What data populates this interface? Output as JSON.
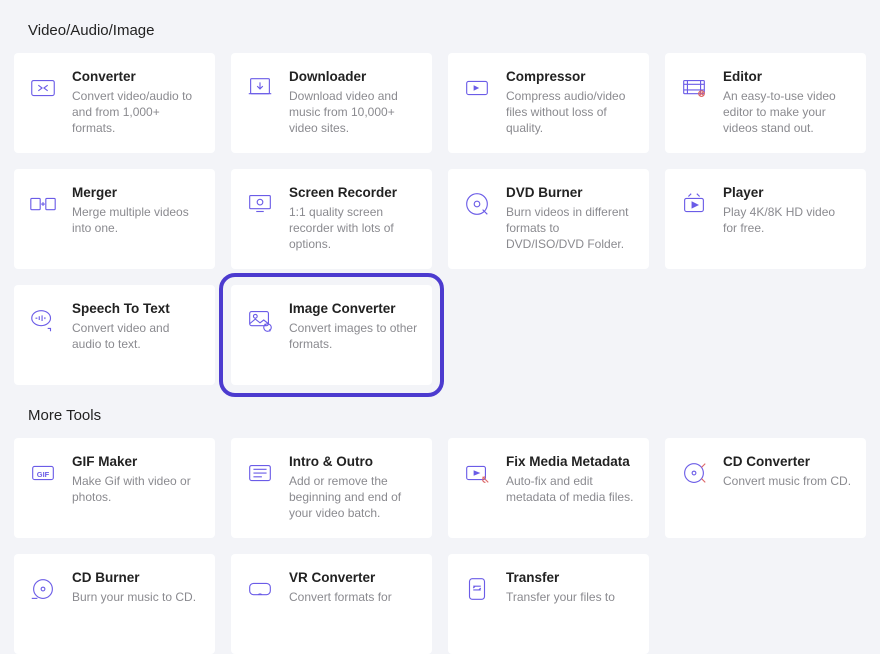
{
  "sections": [
    {
      "title": "Video/Audio/Image",
      "items": [
        {
          "id": "converter",
          "title": "Converter",
          "desc": "Convert video/audio to and from 1,000+ formats.",
          "highlight": false
        },
        {
          "id": "downloader",
          "title": "Downloader",
          "desc": "Download video and music from 10,000+ video sites.",
          "highlight": false
        },
        {
          "id": "compressor",
          "title": "Compressor",
          "desc": "Compress audio/video files without loss of quality.",
          "highlight": false
        },
        {
          "id": "editor",
          "title": "Editor",
          "desc": "An easy-to-use video editor to make your videos stand out.",
          "highlight": false
        },
        {
          "id": "merger",
          "title": "Merger",
          "desc": "Merge multiple videos into one.",
          "highlight": false
        },
        {
          "id": "screen-recorder",
          "title": "Screen Recorder",
          "desc": "1:1 quality screen recorder with lots of options.",
          "highlight": false
        },
        {
          "id": "dvd-burner",
          "title": "DVD Burner",
          "desc": "Burn videos in different formats to DVD/ISO/DVD Folder.",
          "highlight": false
        },
        {
          "id": "player",
          "title": "Player",
          "desc": "Play 4K/8K HD video for free.",
          "highlight": false
        },
        {
          "id": "speech-to-text",
          "title": "Speech To Text",
          "desc": "Convert video and audio to text.",
          "highlight": false
        },
        {
          "id": "image-converter",
          "title": "Image Converter",
          "desc": "Convert images to other formats.",
          "highlight": true
        }
      ]
    },
    {
      "title": "More Tools",
      "items": [
        {
          "id": "gif-maker",
          "title": "GIF Maker",
          "desc": "Make Gif with video or photos.",
          "highlight": false
        },
        {
          "id": "intro-outro",
          "title": "Intro & Outro",
          "desc": "Add or remove the beginning and end of your video batch.",
          "highlight": false
        },
        {
          "id": "fix-media-metadata",
          "title": "Fix Media Metadata",
          "desc": "Auto-fix and edit metadata of media files.",
          "highlight": false
        },
        {
          "id": "cd-converter",
          "title": "CD Converter",
          "desc": "Convert music from CD.",
          "highlight": false
        },
        {
          "id": "cd-burner",
          "title": "CD Burner",
          "desc": "Burn your music to CD.",
          "highlight": false
        },
        {
          "id": "vr-converter",
          "title": "VR Converter",
          "desc": "Convert formats for",
          "highlight": false
        },
        {
          "id": "transfer",
          "title": "Transfer",
          "desc": "Transfer your files to",
          "highlight": false
        }
      ]
    }
  ]
}
